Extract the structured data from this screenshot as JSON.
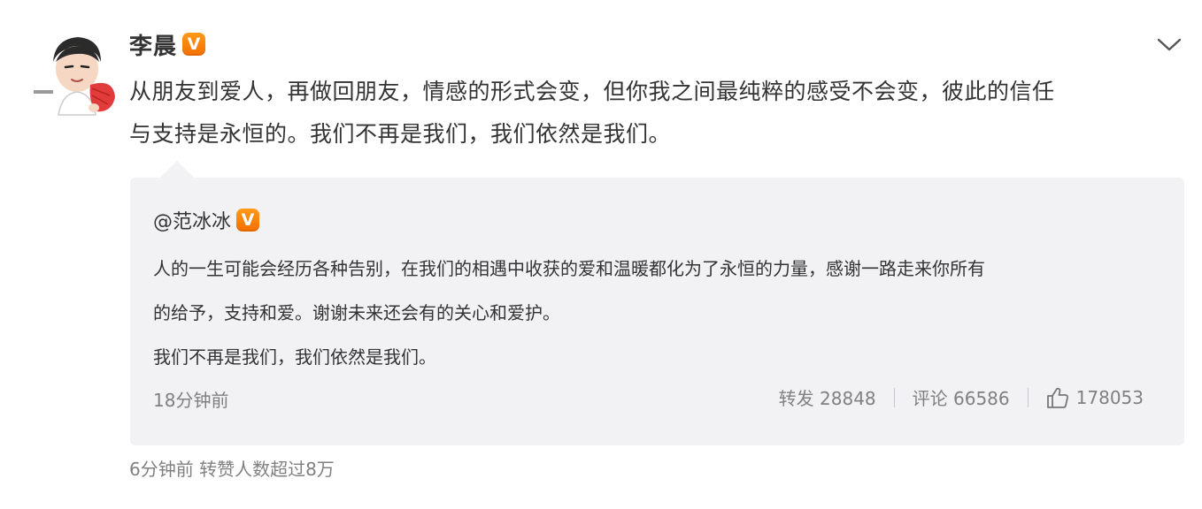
{
  "post": {
    "author": "李晨",
    "verified_badge": "V",
    "text_line1": "从朋友到爱人，再做回朋友，情感的形式会变，但你我之间最纯粹的感受不会变，彼此的信任",
    "text_line2": "与支持是永恒的。我们不再是我们，我们依然是我们。",
    "menu_icon": "chevron-down-icon"
  },
  "repost": {
    "author": "@范冰冰",
    "verified_badge": "V",
    "text_line1": "人的一生可能会经历各种告别，在我们的相遇中收获的爱和温暖都化为了永恒的力量，感谢一路走来你所有",
    "text_line2": "的给予，支持和爱。谢谢未来还会有的关心和爱护。",
    "text_line3": "我们不再是我们，我们依然是我们。",
    "time": "18分钟前",
    "repost_label": "转发 28848",
    "comment_label": "评论 66586",
    "like_count": "178053"
  },
  "footer": {
    "text": "6分钟前 转赞人数超过8万"
  },
  "colors": {
    "badge": "#f56f00",
    "repost_bg": "#f2f2f5",
    "muted_text": "#808080",
    "main_text": "#333333"
  }
}
